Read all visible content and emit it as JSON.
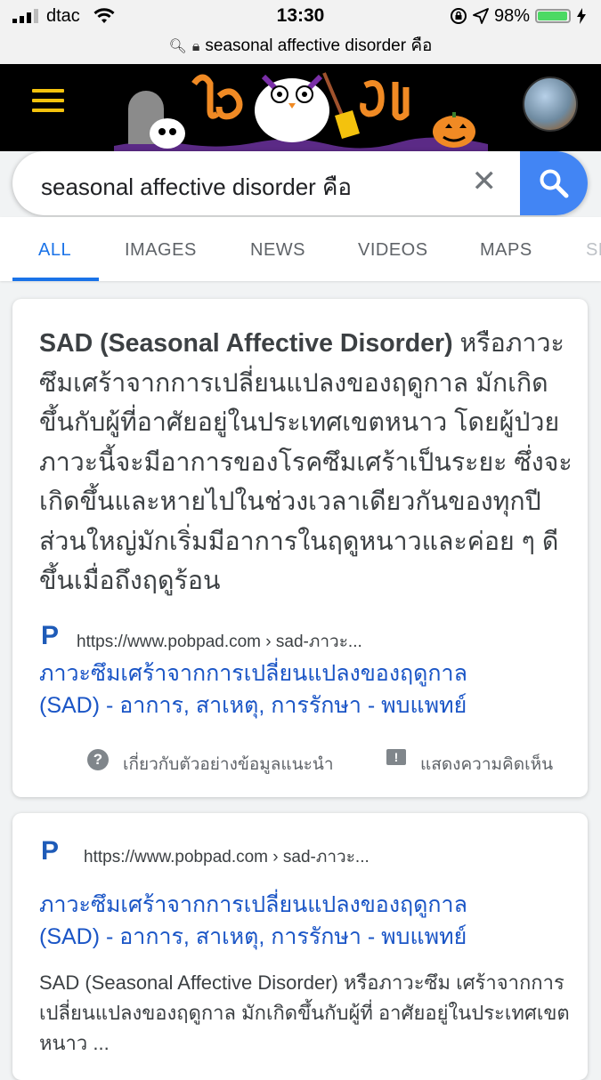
{
  "status_bar": {
    "carrier": "dtac",
    "time": "13:30",
    "battery": "98%",
    "battery_level": 0.98,
    "url": "seasonal affective disorder คือ"
  },
  "search": {
    "query": "seasonal affective disorder คือ"
  },
  "tabs": [
    {
      "label": "ALL"
    },
    {
      "label": "IMAGES"
    },
    {
      "label": "NEWS"
    },
    {
      "label": "VIDEOS"
    },
    {
      "label": "MAPS"
    },
    {
      "label": "SH"
    }
  ],
  "featured_snippet": {
    "bold_term": "SAD (Seasonal Affective Disorder)",
    "text": " หรือภาวะซึมเศร้าจากการเปลี่ยนแปลงของฤดูกาล มักเกิดขึ้นกับผู้ที่อาศัยอยู่ในประเทศเขตหนาว โดยผู้ป่วยภาวะนี้จะมีอาการของโรคซึมเศร้าเป็นระยะ ซึ่งจะเกิดขึ้นและหายไปในช่วงเวลาเดียวกันของทุกปี ส่วนใหญ่มักเริ่มมีอาการในฤดูหนาวและค่อย ๆ ดีขึ้นเมื่อถึงฤดูร้อน",
    "source_favicon": "P",
    "source_url": "https://www.pobpad.com › sad-ภาวะ...",
    "title_line1": "ภาวะซึมเศร้าจากการเปลี่ยนแปลงของฤดูกาล",
    "title_line2": "(SAD) - อาการ, สาเหตุ, การรักษา - พบแพทย์",
    "about_label": "เกี่ยวกับตัวอย่างข้อมูลแนะนำ",
    "feedback_label": "แสดงความคิดเห็น"
  },
  "result": {
    "favicon": "P",
    "source_url": "https://www.pobpad.com › sad-ภาวะ...",
    "title_line1": "ภาวะซึมเศร้าจากการเปลี่ยนแปลงของฤดูกาล",
    "title_line2": "(SAD) - อาการ, สาเหตุ, การรักษา - พบแพทย์",
    "description": "SAD (Seasonal Affective Disorder) หรือภาวะซึม เศร้าจากการเปลี่ยนแปลงของฤดูกาล มักเกิดขึ้นกับผู้ที่ อาศัยอยู่ในประเทศเขตหนาว ..."
  },
  "icons": {
    "lock": "lock-icon",
    "search": "search-icon",
    "clear": "close-icon",
    "menu": "menu-icon"
  },
  "colors": {
    "accent": "#1a73e8",
    "search_button": "#4285f4",
    "link": "#1a55c6",
    "doodle_bg": "#000000",
    "doodle_orange": "#f08a24",
    "menu_yellow": "#f4c20d"
  }
}
